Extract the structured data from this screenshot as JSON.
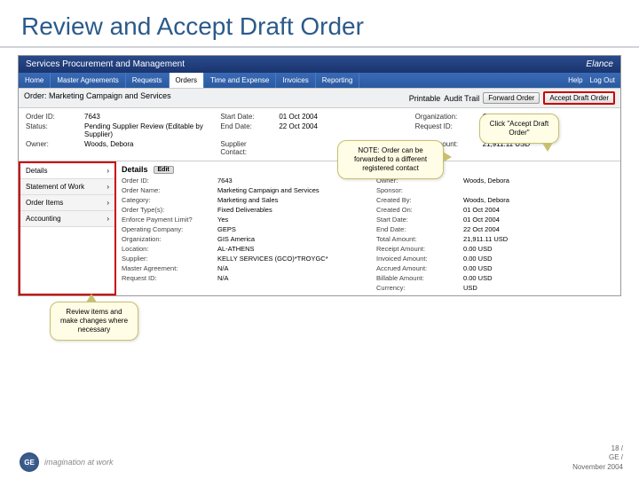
{
  "slide": {
    "title": "Review and Accept Draft Order"
  },
  "header": {
    "app": "Services Procurement and Management",
    "brand": "Elance"
  },
  "nav": {
    "tabs": [
      "Home",
      "Master Agreements",
      "Requests",
      "Orders",
      "Time and Expense",
      "Invoices",
      "Reporting"
    ],
    "active": 3,
    "help": "Help",
    "logout": "Log Out"
  },
  "orderbar": {
    "title": "Order: Marketing Campaign and Services",
    "printable": "Printable",
    "audit": "Audit Trail",
    "forward": "Forward Order",
    "accept": "Accept Draft Order"
  },
  "summary": {
    "order_id_lbl": "Order ID:",
    "order_id": "7643",
    "status_lbl": "Status:",
    "status": "Pending Supplier Review (Editable by Supplier)",
    "owner_lbl": "Owner:",
    "owner": "Woods, Debora",
    "start_lbl": "Start Date:",
    "start": "01 Oct 2004",
    "end_lbl": "End Date:",
    "end": "22 Oct 2004",
    "supcon_lbl": "Supplier Contact:",
    "supcon": "",
    "org_lbl": "Organization:",
    "org": "GIS America",
    "req_lbl": "Request ID:",
    "req": "N/A",
    "tot_lbl": "Total Amount:",
    "tot": "21,911.11 USD"
  },
  "side": {
    "items": [
      "Details",
      "Statement of Work",
      "Order Items",
      "Accounting"
    ],
    "active": 0
  },
  "details": {
    "head": "Details",
    "edit": "Edit",
    "rows": [
      [
        "Order ID:",
        "7643",
        "Owner:",
        "Woods, Debora"
      ],
      [
        "Order Name:",
        "Marketing Campaign and Services",
        "Sponsor:",
        ""
      ],
      [
        "Category:",
        "Marketing and Sales",
        "Created By:",
        "Woods, Debora"
      ],
      [
        "Order Type(s):",
        "Fixed Deliverables",
        "Created On:",
        "01 Oct 2004"
      ],
      [
        "Enforce Payment Limit?",
        "Yes",
        "Start Date:",
        "01 Oct 2004"
      ],
      [
        "Operating Company:",
        "GEPS",
        "End Date:",
        "22 Oct 2004"
      ],
      [
        "Organization:",
        "GIS America",
        "Total Amount:",
        "21,911.11 USD"
      ],
      [
        "Location:",
        "AL-ATHENS",
        "Receipt Amount:",
        "0.00 USD"
      ],
      [
        "Supplier:",
        "KELLY SERVICES (GCO)*TROYGC*",
        "Invoiced Amount:",
        "0.00 USD"
      ],
      [
        "Master Agreement:",
        "N/A",
        "Accrued Amount:",
        "0.00 USD"
      ],
      [
        "Request ID:",
        "N/A",
        "Billable Amount:",
        "0.00 USD"
      ],
      [
        "",
        "",
        "Currency:",
        "USD"
      ]
    ]
  },
  "callouts": {
    "c1": "Click \"Accept Draft Order\"",
    "c2": "NOTE: Order can be forwarded to a different registered contact",
    "c3": "Review items and make changes where necessary"
  },
  "footer": {
    "tagline": "imagination at work",
    "page": "18 /",
    "co": "GE /",
    "date": "November 2004"
  }
}
